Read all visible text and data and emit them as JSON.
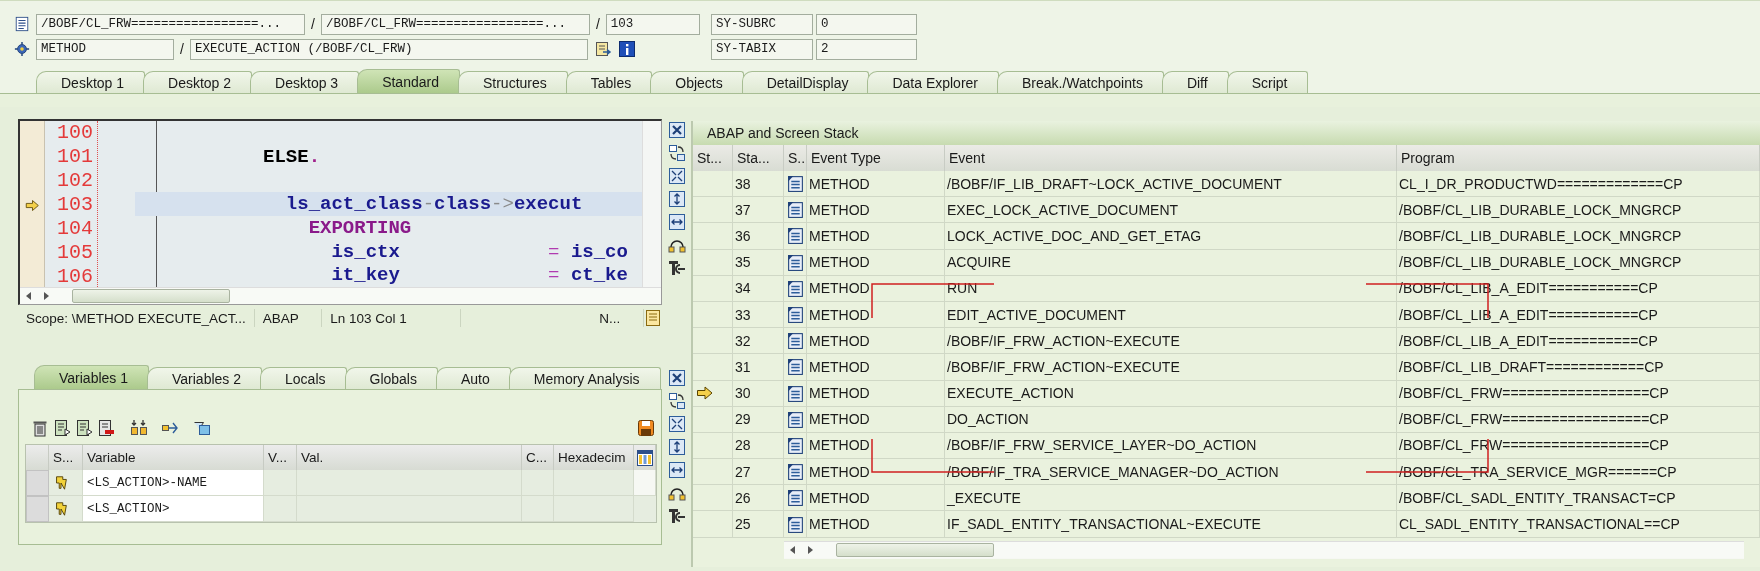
{
  "header": {
    "main_program": "/BOBF/CL_FRW=================...",
    "separator_1": "/",
    "include": "/BOBF/CL_FRW=================...",
    "separator_2": "/",
    "line": "103",
    "event_type": "METHOD",
    "separator_3": "/",
    "event": "EXECUTE_ACTION (/BOBF/CL_FRW)",
    "system_fields": [
      {
        "name": "SY-SUBRC",
        "value": "0"
      },
      {
        "name": "SY-TABIX",
        "value": "2"
      }
    ]
  },
  "tabs": [
    {
      "label": "Desktop 1",
      "selected": false
    },
    {
      "label": "Desktop 2",
      "selected": false
    },
    {
      "label": "Desktop 3",
      "selected": false
    },
    {
      "label": "Standard",
      "selected": true
    },
    {
      "label": "Structures",
      "selected": false
    },
    {
      "label": "Tables",
      "selected": false
    },
    {
      "label": "Objects",
      "selected": false
    },
    {
      "label": "DetailDisplay",
      "selected": false
    },
    {
      "label": "Data Explorer",
      "selected": false
    },
    {
      "label": "Break./Watchpoints",
      "selected": false
    },
    {
      "label": "Diff",
      "selected": false
    },
    {
      "label": "Script",
      "selected": false
    }
  ],
  "source": {
    "lines": [
      {
        "number": "100",
        "current": false
      },
      {
        "number": "101",
        "current": false,
        "tokens": [
          {
            "kind": "keyword",
            "text": "          ELSE"
          },
          {
            "kind": "punct",
            "text": "."
          }
        ]
      },
      {
        "number": "102",
        "current": false
      },
      {
        "number": "103",
        "current": true,
        "tokens": [
          {
            "kind": "ident",
            "text": "            ls_act_class"
          },
          {
            "kind": "op",
            "text": "-"
          },
          {
            "kind": "ident",
            "text": "class"
          },
          {
            "kind": "op",
            "text": "->"
          },
          {
            "kind": "ident",
            "text": "execut"
          }
        ]
      },
      {
        "number": "104",
        "current": false,
        "tokens": [
          {
            "kind": "keyword2",
            "text": "              EXPORTING"
          }
        ]
      },
      {
        "number": "105",
        "current": false,
        "tokens": [
          {
            "kind": "ident",
            "text": "                is_ctx"
          },
          {
            "kind": "eq",
            "text": "             ="
          },
          {
            "kind": "ident",
            "text": " is_co"
          }
        ]
      },
      {
        "number": "106",
        "current": false,
        "tokens": [
          {
            "kind": "ident",
            "text": "                it_key"
          },
          {
            "kind": "eq",
            "text": "             ="
          },
          {
            "kind": "ident",
            "text": " ct_ke"
          }
        ]
      }
    ],
    "status": [
      "Scope: \\METHOD EXECUTE_ACT...",
      "ABAP",
      "Ln 103 Col  1",
      "N..."
    ]
  },
  "variables": {
    "tabs": [
      {
        "label": "Variables 1",
        "selected": true
      },
      {
        "label": "Variables 2",
        "selected": false
      },
      {
        "label": "Locals",
        "selected": false
      },
      {
        "label": "Globals",
        "selected": false
      },
      {
        "label": "Auto",
        "selected": false
      },
      {
        "label": "Memory Analysis",
        "selected": false
      }
    ],
    "columns": [
      "S...",
      "Variable",
      "V...",
      "Val.",
      "C...",
      "Hexadecim"
    ],
    "rows": [
      {
        "variable": "<LS_ACTION>-NAME"
      },
      {
        "variable": "<LS_ACTION>"
      }
    ]
  },
  "stack": {
    "title": "ABAP and Screen Stack",
    "columns": [
      "St...",
      "Sta...",
      "S..",
      "Event Type",
      "Event",
      "Program"
    ],
    "rows": [
      {
        "stack_level": "38",
        "current": false,
        "event_type": "METHOD",
        "event": "/BOBF/IF_LIB_DRAFT~LOCK_ACTIVE_DOCUMENT",
        "program": "CL_I_DR_PRODUCTWD=============CP"
      },
      {
        "stack_level": "37",
        "current": false,
        "event_type": "METHOD",
        "event": "EXEC_LOCK_ACTIVE_DOCUMENT",
        "program": "/BOBF/CL_LIB_DURABLE_LOCK_MNGRCP"
      },
      {
        "stack_level": "36",
        "current": false,
        "event_type": "METHOD",
        "event": "LOCK_ACTIVE_DOC_AND_GET_ETAG",
        "program": "/BOBF/CL_LIB_DURABLE_LOCK_MNGRCP"
      },
      {
        "stack_level": "35",
        "current": false,
        "event_type": "METHOD",
        "event": "ACQUIRE",
        "program": "/BOBF/CL_LIB_DURABLE_LOCK_MNGRCP"
      },
      {
        "stack_level": "34",
        "current": false,
        "event_type": "METHOD",
        "event": "RUN",
        "program": "/BOBF/CL_LIB_A_EDIT===========CP"
      },
      {
        "stack_level": "33",
        "current": false,
        "event_type": "METHOD",
        "event": "EDIT_ACTIVE_DOCUMENT",
        "program": "/BOBF/CL_LIB_A_EDIT===========CP"
      },
      {
        "stack_level": "32",
        "current": false,
        "event_type": "METHOD",
        "event": "/BOBF/IF_FRW_ACTION~EXECUTE",
        "program": "/BOBF/CL_LIB_A_EDIT===========CP"
      },
      {
        "stack_level": "31",
        "current": false,
        "event_type": "METHOD",
        "event": "/BOBF/IF_FRW_ACTION~EXECUTE",
        "program": "/BOBF/CL_LIB_DRAFT============CP"
      },
      {
        "stack_level": "30",
        "current": true,
        "event_type": "METHOD",
        "event": "EXECUTE_ACTION",
        "program": "/BOBF/CL_FRW==================CP"
      },
      {
        "stack_level": "29",
        "current": false,
        "event_type": "METHOD",
        "event": "DO_ACTION",
        "program": "/BOBF/CL_FRW==================CP"
      },
      {
        "stack_level": "28",
        "current": false,
        "event_type": "METHOD",
        "event": "/BOBF/IF_FRW_SERVICE_LAYER~DO_ACTION",
        "program": "/BOBF/CL_FRW==================CP"
      },
      {
        "stack_level": "27",
        "current": false,
        "event_type": "METHOD",
        "event": "/BOBF/IF_TRA_SERVICE_MANAGER~DO_ACTION",
        "program": "/BOBF/CL_TRA_SERVICE_MGR======CP"
      },
      {
        "stack_level": "26",
        "current": false,
        "event_type": "METHOD",
        "event": "_EXECUTE",
        "program": "/BOBF/CL_SADL_ENTITY_TRANSACT=CP"
      },
      {
        "stack_level": "25",
        "current": false,
        "event_type": "METHOD",
        "event": "IF_SADL_ENTITY_TRANSACTIONAL~EXECUTE",
        "program": "CL_SADL_ENTITY_TRANSACTIONAL==CP"
      }
    ]
  }
}
